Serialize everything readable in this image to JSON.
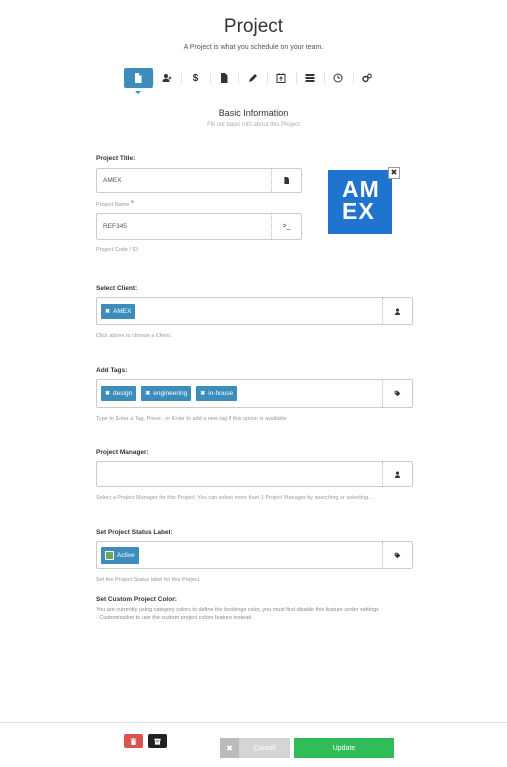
{
  "header": {
    "title": "Project",
    "subtitle": "A Project is what you schedule on your team."
  },
  "steps": [
    {
      "icon": "file-icon",
      "active": true
    },
    {
      "icon": "user-plus-icon",
      "active": false
    },
    {
      "icon": "dollar-icon",
      "active": false
    },
    {
      "icon": "document-icon",
      "active": false
    },
    {
      "icon": "pencil-icon",
      "active": false
    },
    {
      "icon": "calendar-upload-icon",
      "active": false
    },
    {
      "icon": "list-icon",
      "active": false
    },
    {
      "icon": "clock-icon",
      "active": false
    },
    {
      "icon": "cogs-icon",
      "active": false
    }
  ],
  "section": {
    "title": "Basic Information",
    "subtitle": "Fill out basic info about this Project"
  },
  "project_title": {
    "label": "Project Title:",
    "value": "AMEX",
    "help": "Project Name",
    "required_mark": "*"
  },
  "project_code": {
    "value": "REF345",
    "help": "Project Code / ID",
    "addon": ">_"
  },
  "logo": {
    "text_line1": "AM",
    "text_line2": "EX",
    "close": "✖"
  },
  "client": {
    "label": "Select Client:",
    "chips": [
      "AMEX"
    ],
    "help": "Click above to choose a Client."
  },
  "tags": {
    "label": "Add Tags:",
    "chips": [
      "design",
      "engineering",
      "in-house"
    ],
    "help": "Type to Enter a Tag. Press , or Enter to add a new tag if this option is available"
  },
  "manager": {
    "label": "Project Manager:",
    "help": "Select a Project Manager for this Project. You can select more than 1 Project Manager by searching or selecting..."
  },
  "status": {
    "label": "Set Project Status Label:",
    "chip": "Active",
    "chip_color": "#6aa85a",
    "help": "Set the Project Status label for this Project."
  },
  "custom_color": {
    "label": "Set Custom Project Color:",
    "text_line1": "You are currently using category colors to define the bookings color, you must first disable this feature under settings",
    "text_line2": "- Customization to use the custom project colors feature instead."
  },
  "footer": {
    "cancel_label": "Cancel",
    "update_label": "Update"
  },
  "colors": {
    "accent": "#3c8dbc",
    "update": "#2ebd59",
    "delete": "#d9534f",
    "archive": "#222222"
  }
}
